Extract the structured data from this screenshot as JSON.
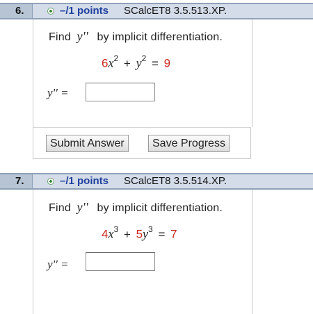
{
  "questions": [
    {
      "number": "6.",
      "points": "–/1 points",
      "code": "SCalcET8 3.5.513.XP.",
      "prompt_pre": "Find",
      "prompt_var": "y''",
      "prompt_post": "by implicit differentiation.",
      "equation": {
        "c1": "6",
        "v1": "x",
        "e1": "2",
        "plus": "+",
        "v2": "y",
        "e2": "2",
        "eq": "=",
        "rhs": "9"
      },
      "answer_label": "y'' =",
      "answer_value": "",
      "submit_label": "Submit Answer",
      "save_label": "Save Progress"
    },
    {
      "number": "7.",
      "points": "–/1 points",
      "code": "SCalcET8 3.5.514.XP.",
      "prompt_pre": "Find",
      "prompt_var": "y''",
      "prompt_post": "by implicit differentiation.",
      "equation": {
        "c1": "4",
        "v1": "x",
        "e1": "3",
        "plus": "+",
        "c2": "5",
        "v2": "y",
        "e2": "3",
        "eq": "=",
        "rhs": "7"
      },
      "answer_label": "y'' =",
      "answer_value": ""
    }
  ],
  "colors": {
    "header_bg": "#d3dce8",
    "number_bg": "#b6c4d4",
    "points_text": "#1f3f9f",
    "highlight_red": "#cc2a1e"
  }
}
